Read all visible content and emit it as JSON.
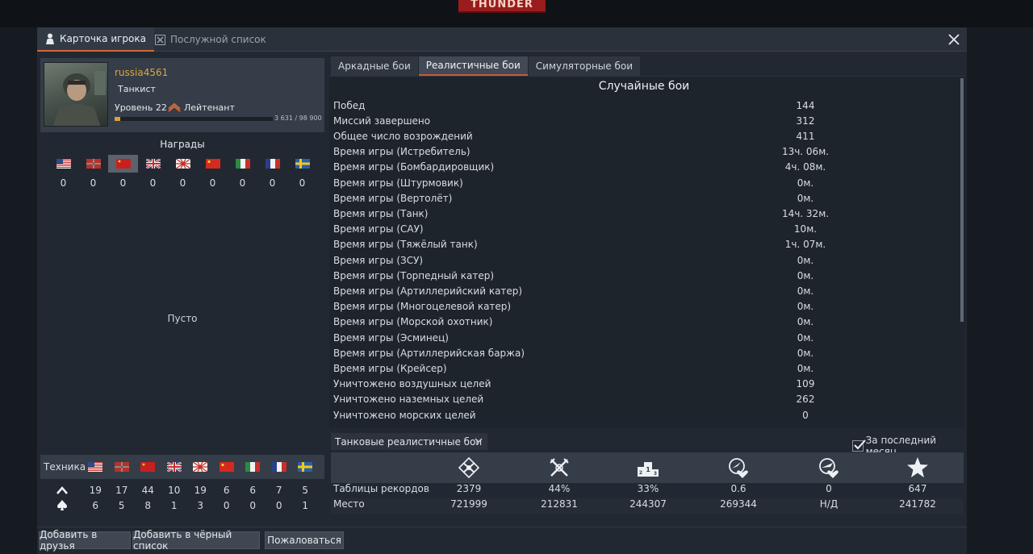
{
  "window": {
    "tabs": [
      {
        "label": "Карточка игрока",
        "active": true
      },
      {
        "label": "Послужной список",
        "active": false
      }
    ]
  },
  "background": {
    "logo_text": "THUNDER"
  },
  "profile": {
    "nickname": "russia4561",
    "title": "Танкист",
    "level": "Уровень 22",
    "rank": "Лейтенант",
    "xp_text": "3 631 / 98 900",
    "xp_fraction": 0.037
  },
  "awards": {
    "title": "Награды",
    "flags": [
      "usa",
      "germany",
      "ussr",
      "uk",
      "japan",
      "china",
      "italy",
      "france",
      "sweden"
    ],
    "selected_index": 2,
    "counts": [
      "0",
      "0",
      "0",
      "0",
      "0",
      "0",
      "0",
      "0",
      "0"
    ],
    "empty_text": "Пусто"
  },
  "vehicles": {
    "label": "Техника",
    "flags": [
      "usa",
      "germany",
      "ussr",
      "uk",
      "japan",
      "china",
      "italy",
      "france",
      "sweden"
    ],
    "row1_icon": "chevron-up-icon",
    "row1": [
      "19",
      "17",
      "44",
      "10",
      "19",
      "6",
      "6",
      "7",
      "5"
    ],
    "row2_icon": "spade-icon",
    "row2": [
      "6",
      "5",
      "8",
      "1",
      "3",
      "0",
      "0",
      "0",
      "1"
    ]
  },
  "buttons": {
    "add_friend": "Добавить в друзья",
    "blacklist": "Добавить в чёрный список",
    "report": "Пожаловаться"
  },
  "modes": [
    {
      "label": "Аркадные бои",
      "active": false
    },
    {
      "label": "Реалистичные бои",
      "active": true
    },
    {
      "label": "Симуляторные бои",
      "active": false
    }
  ],
  "stats": {
    "section_title": "Случайные бои",
    "rows": [
      {
        "label": "Побед",
        "value": "144"
      },
      {
        "label": "Миссий завершено",
        "value": "312"
      },
      {
        "label": "Общее число возрождений",
        "value": "411"
      },
      {
        "label": "Время игры (Истребитель)",
        "value": "13ч. 06м."
      },
      {
        "label": "Время игры (Бомбардировщик)",
        "value": "4ч. 08м."
      },
      {
        "label": "Время игры (Штурмовик)",
        "value": "0м."
      },
      {
        "label": "Время игры (Вертолёт)",
        "value": "0м."
      },
      {
        "label": "Время игры (Танк)",
        "value": "14ч. 32м."
      },
      {
        "label": "Время игры (САУ)",
        "value": "10м."
      },
      {
        "label": "Время игры (Тяжёлый танк)",
        "value": "1ч. 07м."
      },
      {
        "label": "Время игры (ЗСУ)",
        "value": "0м."
      },
      {
        "label": "Время игры (Торпедный катер)",
        "value": "0м."
      },
      {
        "label": "Время игры (Артиллерийский катер)",
        "value": "0м."
      },
      {
        "label": "Время игры (Многоцелевой катер)",
        "value": "0м."
      },
      {
        "label": "Время игры (Морской охотник)",
        "value": "0м."
      },
      {
        "label": "Время игры (Эсминец)",
        "value": "0м."
      },
      {
        "label": "Время игры (Артиллерийская баржа)",
        "value": "0м."
      },
      {
        "label": "Время игры (Крейсер)",
        "value": "0м."
      },
      {
        "label": "Уничтожено воздушных целей",
        "value": "109"
      },
      {
        "label": "Уничтожено наземных целей",
        "value": "262"
      },
      {
        "label": "Уничтожено морских целей",
        "value": "0"
      }
    ]
  },
  "leaderboard": {
    "mode_select": "Танковые реалистичные бои",
    "last_month_label": "За последний месяц",
    "last_month_checked": true,
    "icons": [
      "victories-icon",
      "win-rate-icon",
      "placement-icon",
      "kd-air-icon",
      "kd-ground-icon",
      "star-icon"
    ],
    "rows": [
      {
        "label": "Таблицы рекордов",
        "values": [
          "2379",
          "44%",
          "33%",
          "0.6",
          "0",
          "647"
        ]
      },
      {
        "label": "Место",
        "values": [
          "721999",
          "212831",
          "244307",
          "269344",
          "Н/Д",
          "241782"
        ]
      }
    ]
  },
  "colors": {
    "accent": "#d0683a",
    "nickname": "#e0a340",
    "xp_bar": "#d9a13a"
  }
}
